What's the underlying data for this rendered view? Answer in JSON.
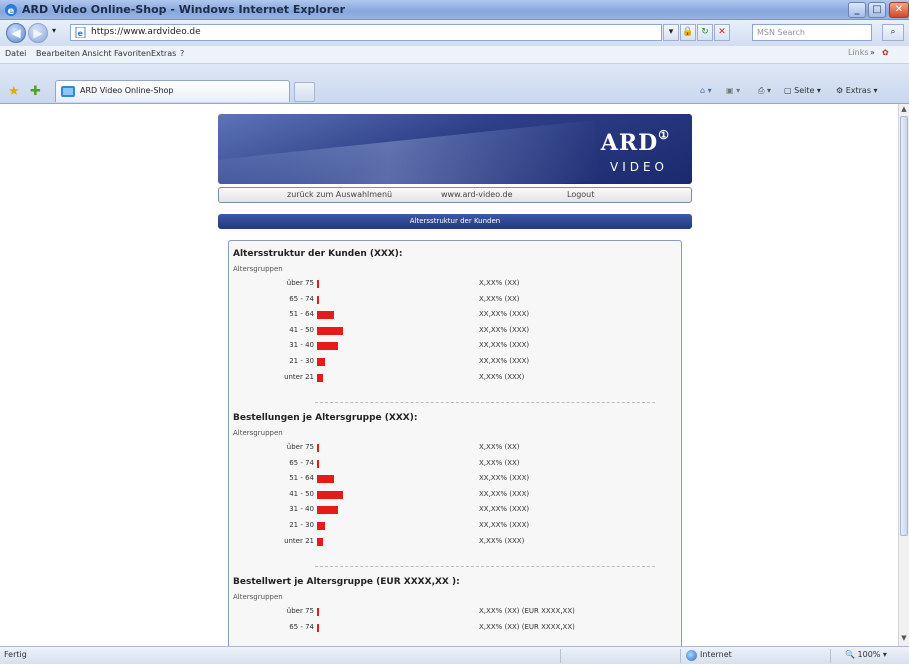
{
  "window": {
    "title": "ARD Video Online-Shop - Windows Internet Explorer"
  },
  "address": {
    "url": "https://www.ardvideo.de",
    "search_placeholder": "MSN Search"
  },
  "menu": {
    "items": [
      "Datei",
      "Bearbeiten",
      "Ansicht",
      "Favoriten",
      "Extras",
      "?"
    ],
    "links_label": "Links"
  },
  "tab": {
    "label": "ARD Video Online-Shop"
  },
  "commandbar": {
    "page_label": "Seite",
    "tools_label": "Extras"
  },
  "banner": {
    "logo_text": "ARD",
    "logo_mark": "①",
    "sub_text": "VIDEO"
  },
  "nav": {
    "back_label": "zurück zum Auswahlmenü",
    "site_label": "www.ard-video.de",
    "logout_label": "Logout"
  },
  "section_bar": {
    "label": "Altersstruktur der Kunden"
  },
  "sections": [
    {
      "title": "Altersstruktur der Kunden (XXX):",
      "subtitle": "Altersgruppen",
      "rows": [
        {
          "label": "über 75",
          "share": 0.05,
          "value": "X,XX% (XX)"
        },
        {
          "label": "65 - 74",
          "share": 0.08,
          "value": "X,XX% (XX)"
        },
        {
          "label": "51 - 64",
          "share": 0.55,
          "value": "XX,XX% (XXX)"
        },
        {
          "label": "41 - 50",
          "share": 0.85,
          "value": "XX,XX% (XXX)"
        },
        {
          "label": "31 - 40",
          "share": 0.7,
          "value": "XX,XX% (XXX)"
        },
        {
          "label": "21 - 30",
          "share": 0.25,
          "value": "XX,XX% (XXX)"
        },
        {
          "label": "unter 21",
          "share": 0.2,
          "value": "X,XX% (XXX)"
        }
      ]
    },
    {
      "title": "Bestellungen je Altersgruppe (XXX):",
      "subtitle": "Altersgruppen",
      "rows": [
        {
          "label": "über 75",
          "share": 0.05,
          "value": "X,XX% (XX)"
        },
        {
          "label": "65 - 74",
          "share": 0.08,
          "value": "X,XX% (XX)"
        },
        {
          "label": "51 - 64",
          "share": 0.55,
          "value": "XX,XX% (XXX)"
        },
        {
          "label": "41 - 50",
          "share": 0.85,
          "value": "XX,XX% (XXX)"
        },
        {
          "label": "31 - 40",
          "share": 0.7,
          "value": "XX,XX% (XXX)"
        },
        {
          "label": "21 - 30",
          "share": 0.25,
          "value": "XX,XX% (XXX)"
        },
        {
          "label": "unter 21",
          "share": 0.2,
          "value": "X,XX% (XXX)"
        }
      ]
    },
    {
      "title": "Bestellwert je Altersgruppe (EUR XXXX,XX ):",
      "subtitle": "Altersgruppen",
      "rows": [
        {
          "label": "über 75",
          "share": 0.05,
          "value": "X,XX% (XX) (EUR XXXX,XX)"
        },
        {
          "label": "65 - 74",
          "share": 0.08,
          "value": "X,XX% (XX) (EUR XXXX,XX)"
        }
      ]
    }
  ],
  "status": {
    "text": "Fertig",
    "zone": "Internet",
    "zoom": "100%"
  },
  "colors": {
    "bar": "#e41b17",
    "banner": "#2d3f87"
  }
}
